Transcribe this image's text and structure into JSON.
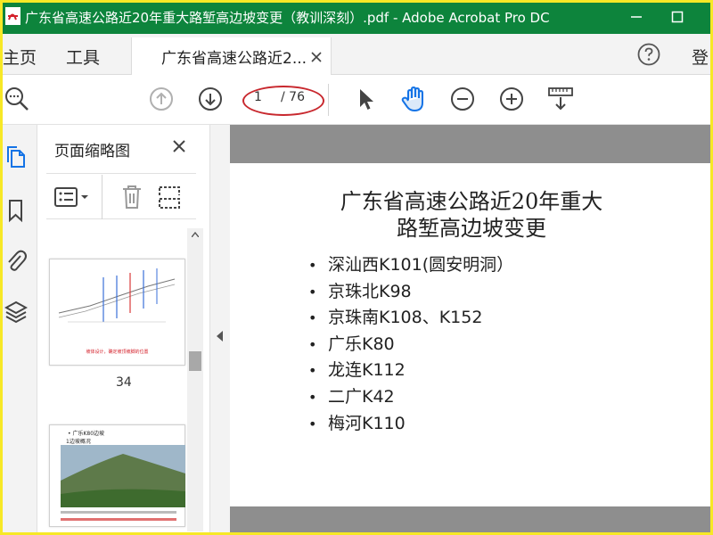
{
  "window": {
    "title": "广东省高速公路近20年重大路堑高边坡变更（教训深刻）.pdf - Adobe Acrobat Pro DC",
    "app_icon": "acrobat-icon",
    "accent_color": "#0d843c"
  },
  "tabs": {
    "home": "主页",
    "tools": "工具",
    "document": "广东省高速公路近2...",
    "signin": "登"
  },
  "toolbar": {
    "page_current": "1",
    "page_total": "/ 76",
    "icons": [
      "search-icon",
      "prev-page-icon",
      "next-page-icon",
      "select-arrow-icon",
      "hand-tool-icon",
      "zoom-out-icon",
      "zoom-in-icon",
      "measure-download-icon"
    ]
  },
  "thumbnails_panel": {
    "title": "页面缩略图",
    "thumbnails": [
      {
        "page_label": "34",
        "caption": "坡体设计，确定坡顶坡脚的位置"
      },
      {
        "page_label": "",
        "heading": "• 广乐K80边坡",
        "subheading": "1边坡概况"
      }
    ]
  },
  "slide": {
    "title_line1": "广东省高速公路近20年重大",
    "title_line2": "路堑高边坡变更",
    "bullets": [
      "深汕西K101(圆安明洞）",
      "京珠北K98",
      "京珠南K108、K152",
      "广乐K80",
      "龙连K112",
      "二广K42",
      "梅河K110"
    ]
  }
}
